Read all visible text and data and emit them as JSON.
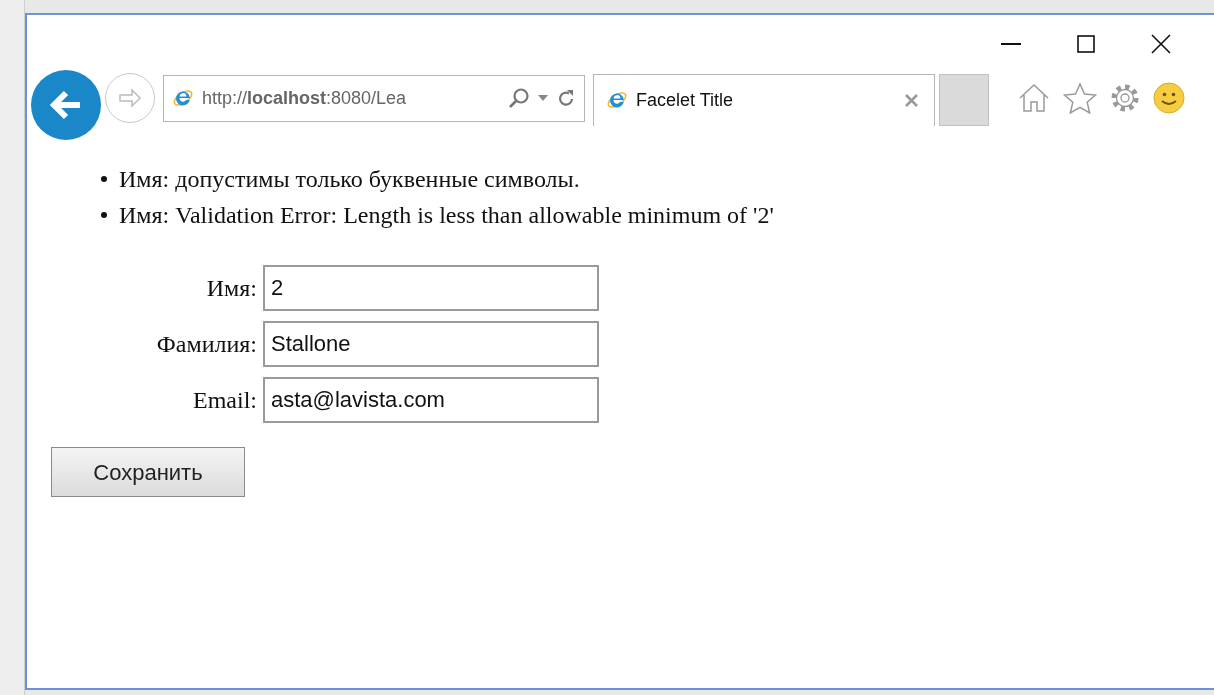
{
  "browser": {
    "address_bar": {
      "url": "http://**localhost**:8080/Lea"
    },
    "tabs": [
      {
        "title": "Facelet Title",
        "selected": true
      }
    ]
  },
  "page": {
    "errors": [
      "Имя: допустимы только буквенные символы.",
      "Имя: Validation Error: Length is less than allowable minimum of '2'"
    ],
    "fields": [
      {
        "label": "Имя:",
        "value": "2"
      },
      {
        "label": "Фамилия:",
        "value": "Stallone"
      },
      {
        "label": "Email:",
        "value": "asta@lavista.com"
      }
    ],
    "buttons": [
      "Сохранить"
    ]
  }
}
